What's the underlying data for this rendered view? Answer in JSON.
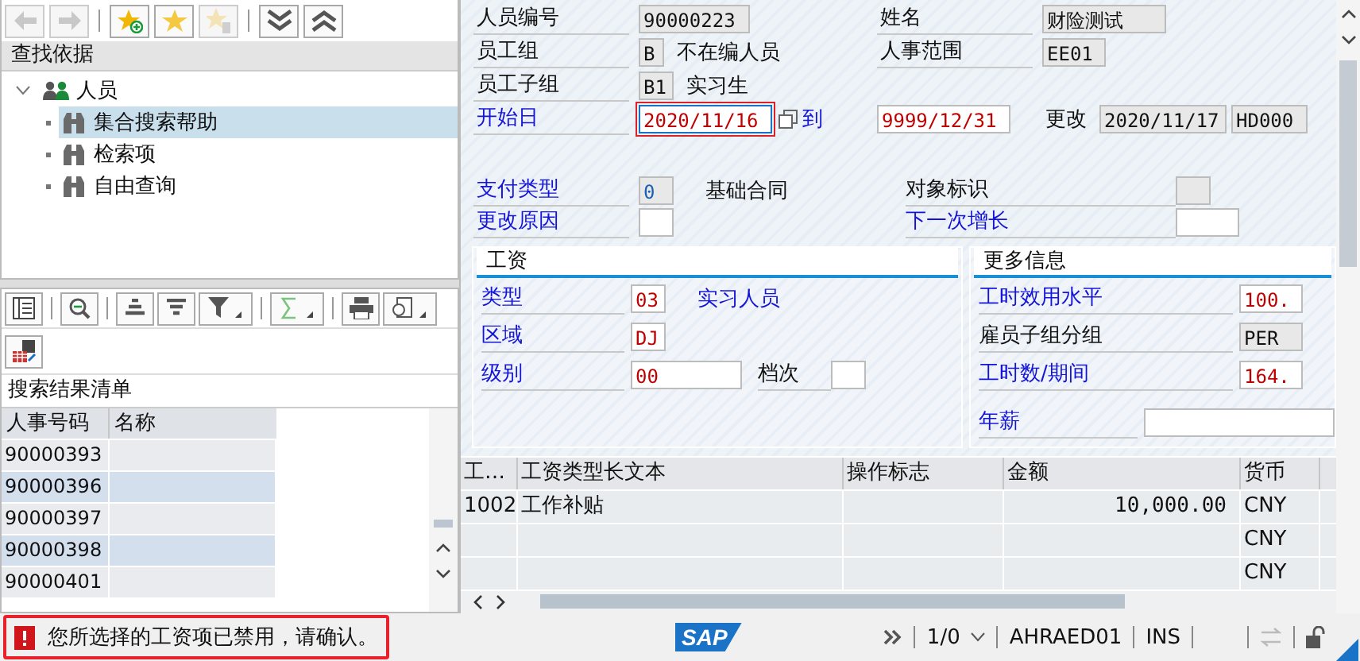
{
  "nav_toolbar": {
    "buttons": [
      {
        "kind": "back",
        "disabled": true
      },
      {
        "kind": "forward",
        "disabled": true
      },
      {
        "kind": "add-favorite",
        "disabled": false
      },
      {
        "kind": "favorite",
        "disabled": false
      },
      {
        "kind": "delete-favorite",
        "disabled": true
      },
      {
        "kind": "expand-all",
        "disabled": false
      },
      {
        "kind": "collapse-all",
        "disabled": false
      }
    ]
  },
  "search_tree": {
    "title": "查找依据",
    "items": [
      {
        "label": "人员",
        "expanded": true,
        "selected": false,
        "children": [
          {
            "label": "集合搜索帮助",
            "selected": true
          },
          {
            "label": "检索项",
            "selected": false
          },
          {
            "label": "自由查询",
            "selected": false
          }
        ]
      }
    ]
  },
  "results": {
    "title": "搜索结果清单",
    "columns": [
      "人事号码",
      "名称"
    ],
    "rows": [
      {
        "number": "90000393"
      },
      {
        "number": "90000396"
      },
      {
        "number": "90000397"
      },
      {
        "number": "90000398"
      },
      {
        "number": "90000401"
      }
    ]
  },
  "form": {
    "personnel_number": {
      "label": "人员编号",
      "value": "90000223"
    },
    "name": {
      "label": "姓名",
      "value": "财险测试"
    },
    "employee_group": {
      "label": "员工组",
      "value": "B",
      "text": "不在编人员"
    },
    "personnel_area": {
      "label": "人事范围",
      "value": "EE01"
    },
    "employee_subgroup": {
      "label": "员工子组",
      "value": "B1",
      "text": "实习生"
    },
    "start_date": {
      "label": "开始日",
      "value": "2020/11/16",
      "focused": true
    },
    "end_date": {
      "label": "到",
      "value": "9999/12/31"
    },
    "changed": {
      "label": "更改",
      "date": "2020/11/17",
      "user": "HD000"
    },
    "payment_type": {
      "label": "支付类型",
      "value": "0",
      "text": "基础合同"
    },
    "object_id": {
      "label": "对象标识"
    },
    "change_reason": {
      "label": "更改原因"
    },
    "next_increase": {
      "label": "下一次增长"
    }
  },
  "pay": {
    "title": "工资",
    "type": {
      "label": "类型",
      "value": "03",
      "text": "实习人员"
    },
    "area": {
      "label": "区域",
      "value": "DJ"
    },
    "level": {
      "label": "级别",
      "value": "00"
    },
    "grade": {
      "label": "档次"
    }
  },
  "more_info": {
    "title": "更多信息",
    "rows": [
      {
        "label": "工时效用水平",
        "value": "100.",
        "kind": "input"
      },
      {
        "label": "雇员子组分组",
        "value": "PER",
        "kind": "display"
      },
      {
        "label": "工时数/期间",
        "value": "164.",
        "kind": "input"
      },
      {
        "label": "年薪",
        "kind": "wide"
      }
    ]
  },
  "wage_table": {
    "columns": [
      "工…",
      "工资类型长文本",
      "操作标志",
      "金额",
      "货币"
    ],
    "rows": [
      {
        "wage_type": "1002",
        "text": "工作补贴",
        "amount": "10,000.00",
        "currency": "CNY"
      },
      {
        "currency": "CNY"
      },
      {
        "currency": "CNY"
      }
    ]
  },
  "status_bar": {
    "message": "您所选择的工资项已禁用，请确认。",
    "logo": "SAP",
    "session": "1/0",
    "program": "AHRAED01",
    "mode": "INS"
  }
}
